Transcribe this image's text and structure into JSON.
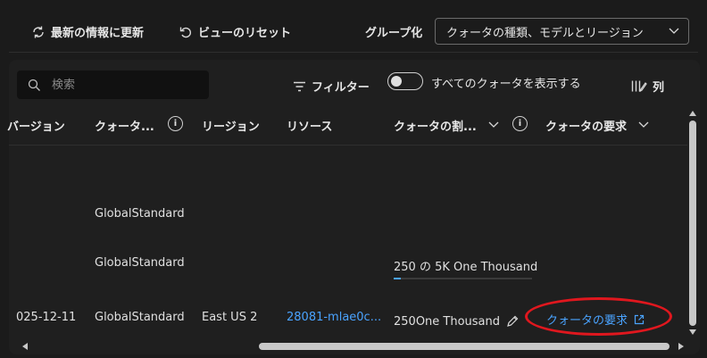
{
  "toolbar": {
    "refresh_label": "最新の情報に更新",
    "reset_view_label": "ビューのリセット",
    "group_by_label": "グループ化",
    "group_by_value": "クォータの種類、モデルとリージョン"
  },
  "filters": {
    "search_placeholder": "検索",
    "filter_label": "フィルター",
    "show_all_label": "すべてのクォータを表示する",
    "show_all_on": false,
    "columns_label": "列"
  },
  "table": {
    "headers": {
      "version": "バージョン",
      "quota_type": "クォータ...",
      "region": "リージョン",
      "resource": "リソース",
      "quota_alloc": "クォータの割...",
      "quota_request": "クォータの要求"
    },
    "rows": [
      {
        "quota_type": "GlobalStandard"
      },
      {
        "quota_type": "GlobalStandard",
        "quota_alloc": "250 の 5K One Thousand",
        "progress": 0.05
      },
      {
        "version": "025-12-11",
        "quota_type": "GlobalStandard",
        "region": "East US 2",
        "resource": "28081-mlae0c...",
        "quota_alloc": "250One Thousand",
        "request_link": "クォータの要求"
      }
    ]
  },
  "colors": {
    "accent": "#4aa3ff",
    "highlight": "#e0171e"
  }
}
